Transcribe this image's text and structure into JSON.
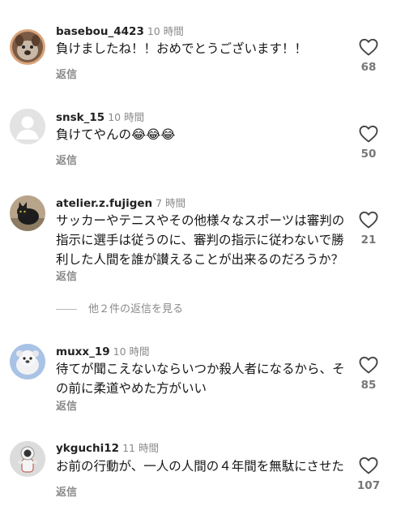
{
  "comments": [
    {
      "username": "basebou_4423",
      "time": "10 時間",
      "text": "負けましたね！！おめでとうございます！！",
      "reply": "返信",
      "likes": "68",
      "avatar": "photo-avatar-dog"
    },
    {
      "username": "snsk_15",
      "time": "10 時間",
      "text": "負けてやんの😂😂😂",
      "reply": "返信",
      "likes": "50",
      "avatar": "default-avatar"
    },
    {
      "username": "atelier.z.fujigen",
      "time": "7 時間",
      "text": "サッカーやテニスやその他様々なスポーツは審判の指示に選手は従うのに、審判の指示に従わないで勝利した人間を誰が讃えることが出来るのだろうか？",
      "reply": "返信",
      "likes": "21",
      "avatar": "photo-avatar-cat"
    },
    {
      "username": "muxx_19",
      "time": "10 時間",
      "text": "待てが聞こえないならいつか殺人者になるから、その前に柔道やめた方がいい",
      "reply": "返信",
      "likes": "85",
      "avatar": "photo-avatar-plush"
    },
    {
      "username": "ykguchi12",
      "time": "11 時間",
      "text": "お前の行動が、一人の人間の４年間を無駄にさせた",
      "reply": "返信",
      "likes": "107",
      "avatar": "photo-avatar-astronaut"
    }
  ],
  "more_replies": "他２件の返信を見る",
  "icons": {
    "like": "heart-outline-icon"
  }
}
